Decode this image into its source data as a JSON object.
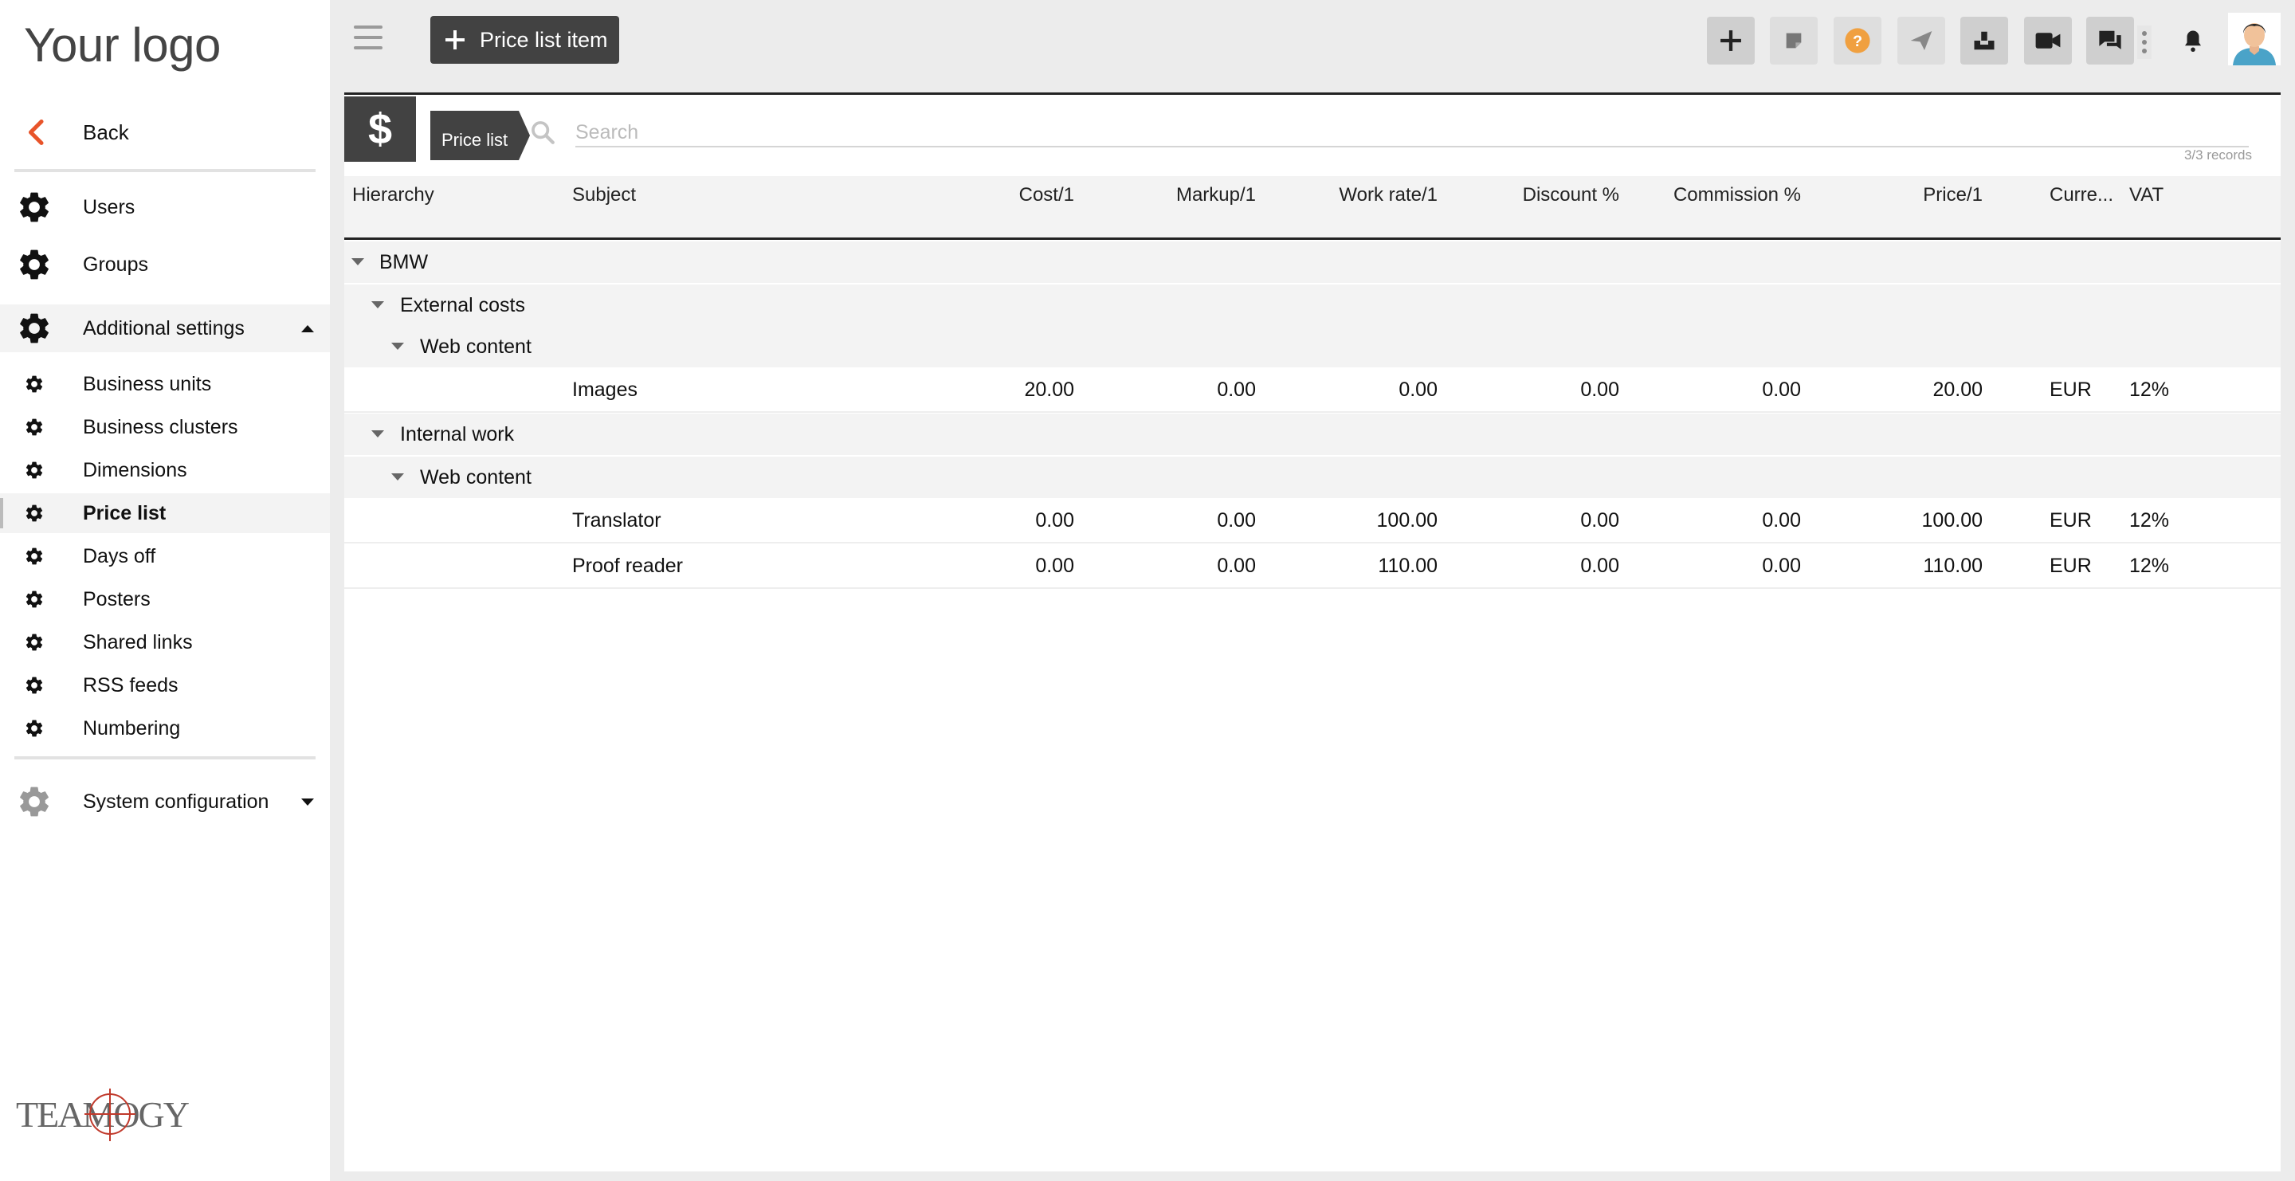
{
  "sidebar": {
    "logo": "Your logo",
    "back_label": "Back",
    "top_items": [
      {
        "label": "Users",
        "icon": "gear-icon"
      },
      {
        "label": "Groups",
        "icon": "gear-icon"
      }
    ],
    "additional_settings": {
      "label": "Additional settings",
      "expanded": true,
      "items": [
        {
          "label": "Business units",
          "icon": "gear-icon"
        },
        {
          "label": "Business clusters",
          "icon": "gear-icon"
        },
        {
          "label": "Dimensions",
          "icon": "gear-icon"
        },
        {
          "label": "Price list",
          "icon": "gear-icon",
          "active": true
        },
        {
          "label": "Days off",
          "icon": "gear-icon"
        },
        {
          "label": "Posters",
          "icon": "gear-icon"
        },
        {
          "label": "Shared links",
          "icon": "gear-icon"
        },
        {
          "label": "RSS feeds",
          "icon": "gear-icon"
        },
        {
          "label": "Numbering",
          "icon": "gear-icon"
        }
      ]
    },
    "system_configuration": {
      "label": "System configuration",
      "expanded": false
    },
    "brand": "TEAMOGY"
  },
  "toolbar": {
    "menu_icon": "hamburger-icon",
    "add_button_label": "Price list item",
    "right_icons": [
      "plus-icon",
      "note-icon",
      "help-icon",
      "send-icon",
      "inbox-icon",
      "video-icon",
      "chat-icon",
      "more-icon",
      "bell-icon",
      "avatar"
    ]
  },
  "panel": {
    "section_icon": "$",
    "breadcrumb": "Price list",
    "search": {
      "placeholder": "Search",
      "value": ""
    },
    "records": "3/3 records",
    "columns": {
      "hierarchy": "Hierarchy",
      "subject": "Subject",
      "cost": "Cost/1",
      "markup": "Markup/1",
      "work_rate": "Work rate/1",
      "discount": "Discount %",
      "commission": "Commission %",
      "price": "Price/1",
      "currency": "Curre...",
      "vat": "VAT"
    },
    "groups": {
      "bmw": "BMW",
      "external_costs": "External costs",
      "web_content_1": "Web content",
      "internal_work": "Internal work",
      "web_content_2": "Web content"
    },
    "items": [
      {
        "subject": "Images",
        "cost": "20.00",
        "markup": "0.00",
        "work_rate": "0.00",
        "discount": "0.00",
        "commission": "0.00",
        "price": "20.00",
        "currency": "EUR",
        "vat": "12%"
      },
      {
        "subject": "Translator",
        "cost": "0.00",
        "markup": "0.00",
        "work_rate": "100.00",
        "discount": "0.00",
        "commission": "0.00",
        "price": "100.00",
        "currency": "EUR",
        "vat": "12%"
      },
      {
        "subject": "Proof reader",
        "cost": "0.00",
        "markup": "0.00",
        "work_rate": "110.00",
        "discount": "0.00",
        "commission": "0.00",
        "price": "110.00",
        "currency": "EUR",
        "vat": "12%"
      }
    ]
  },
  "colors": {
    "accent_back": "#e8542a",
    "dark": "#424242",
    "help": "#f0a040"
  }
}
